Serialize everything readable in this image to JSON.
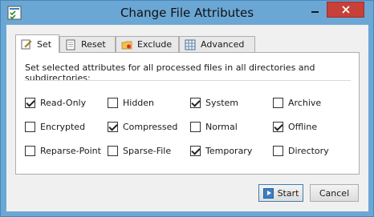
{
  "window": {
    "title": "Change File Attributes",
    "app_icon": "checklist-icon",
    "close_icon": "close-icon",
    "minimize_icon": "minimize-icon"
  },
  "tabs": [
    {
      "label": "Set",
      "icon": "pencil-notepad-icon",
      "active": true
    },
    {
      "label": "Reset",
      "icon": "document-icon",
      "active": false
    },
    {
      "label": "Exclude",
      "icon": "folder-icon",
      "active": false
    },
    {
      "label": "Advanced",
      "icon": "grid-icon",
      "active": false
    }
  ],
  "panel": {
    "description": "Set selected attributes for all processed files in all directories and subdirectories:",
    "attributes": [
      {
        "label": "Read-Only",
        "checked": true
      },
      {
        "label": "Hidden",
        "checked": false
      },
      {
        "label": "System",
        "checked": true
      },
      {
        "label": "Archive",
        "checked": false
      },
      {
        "label": "Encrypted",
        "checked": false
      },
      {
        "label": "Compressed",
        "checked": true
      },
      {
        "label": "Normal",
        "checked": false
      },
      {
        "label": "Offline",
        "checked": true
      },
      {
        "label": "Reparse-Point",
        "checked": false
      },
      {
        "label": "Sparse-File",
        "checked": false
      },
      {
        "label": "Temporary",
        "checked": true
      },
      {
        "label": "Directory",
        "checked": false
      }
    ]
  },
  "buttons": {
    "start_label": "Start",
    "start_icon": "play-icon",
    "cancel_label": "Cancel"
  },
  "colors": {
    "titlebar": "#6ba7d5",
    "close_button": "#c7403a"
  }
}
